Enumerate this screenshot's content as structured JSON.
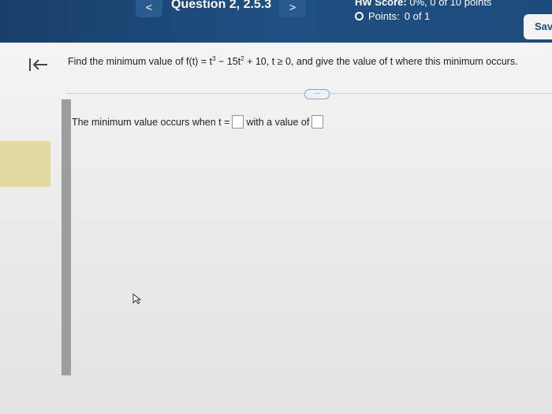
{
  "header": {
    "prev_label": "<",
    "question_title": "Question 2, 2.5.3",
    "next_label": ">",
    "hw_score_label": "HW Score:",
    "hw_score_value": "0%, 0 of 10 points",
    "points_label": "Points:",
    "points_value": "0 of 1",
    "save_label": "Sav"
  },
  "question": {
    "part1": "Find the minimum value of f(t) = t",
    "exp1": "3",
    "part2": " − 15t",
    "exp2": "2",
    "part3": " + 10, t ≥ 0, and give the value of t where this minimum occurs."
  },
  "more_label": "⋯",
  "answer": {
    "prefix": "The minimum value occurs when t =",
    "middle": "with a value of",
    "t_value": "",
    "min_value": ""
  }
}
